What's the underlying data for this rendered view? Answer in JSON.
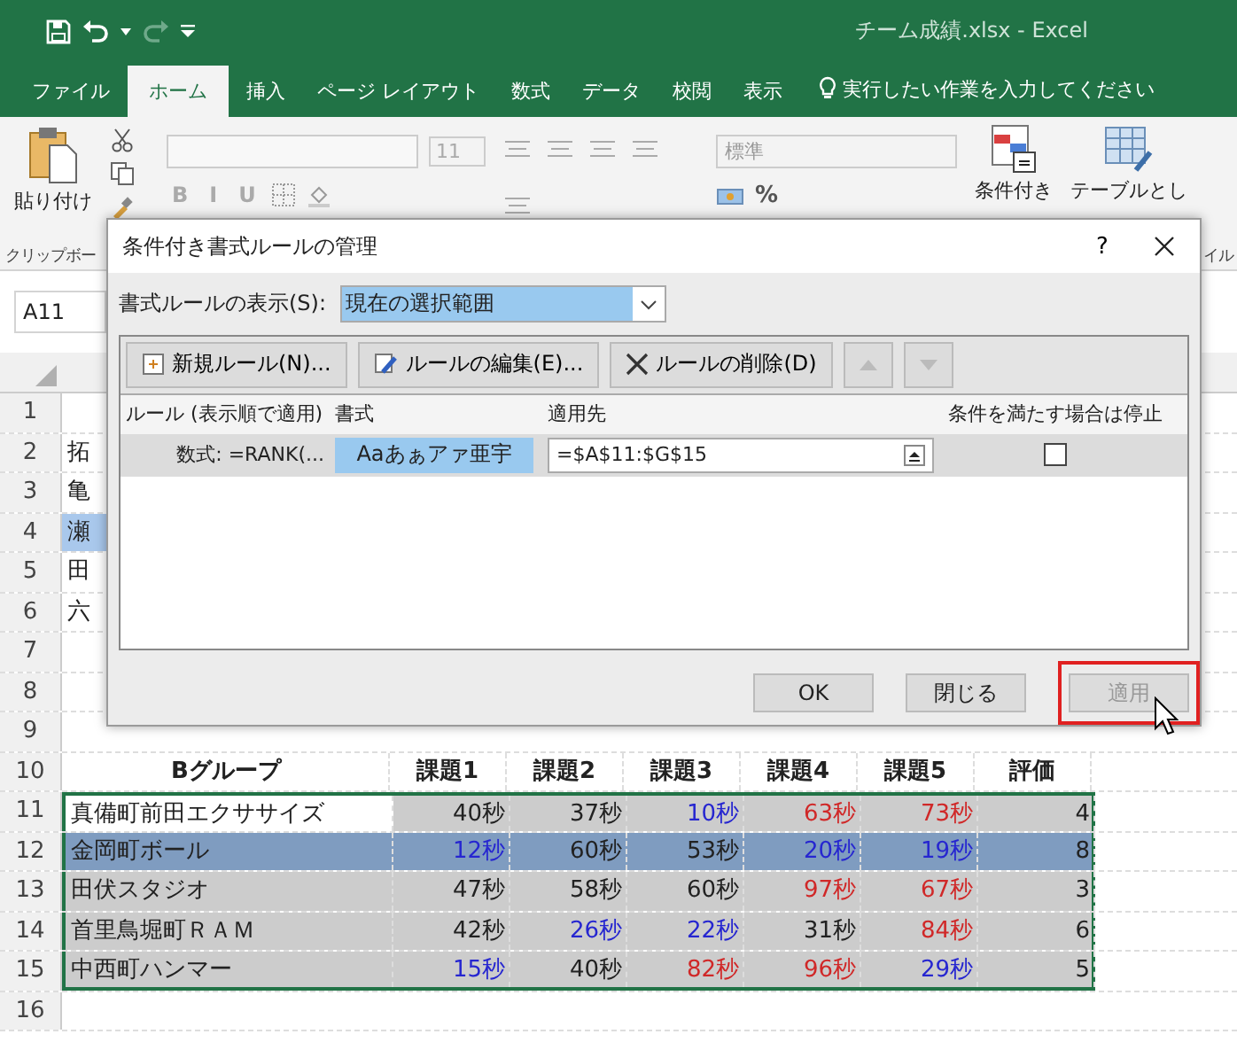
{
  "window": {
    "title": "チーム成績.xlsx  -  Excel"
  },
  "tabs": [
    {
      "label": "ファイル",
      "selected": false
    },
    {
      "label": "ホーム",
      "selected": true
    },
    {
      "label": "挿入",
      "selected": false
    },
    {
      "label": "ページ レイアウト",
      "selected": false
    },
    {
      "label": "数式",
      "selected": false
    },
    {
      "label": "データ",
      "selected": false
    },
    {
      "label": "校閲",
      "selected": false
    },
    {
      "label": "表示",
      "selected": false
    }
  ],
  "tell_me": "実行したい作業を入力してください",
  "ribbon": {
    "paste": "貼り付け",
    "font_size": "11",
    "font_styles": [
      "B",
      "I",
      "U"
    ],
    "number_format": "標準",
    "percent": "%",
    "conditional": "条件付き",
    "table": "テーブルとし",
    "group_left": "クリップボー",
    "group_right": "イル"
  },
  "name_box": "A11",
  "rows": [
    {
      "number": "1",
      "kind": "empty"
    },
    {
      "number": "2",
      "kind": "stub",
      "name": "拓",
      "highlighted": false
    },
    {
      "number": "3",
      "kind": "stub",
      "name": "亀",
      "highlighted": false
    },
    {
      "number": "4",
      "kind": "stub",
      "name": "瀬",
      "highlighted": true
    },
    {
      "number": "5",
      "kind": "stub",
      "name": "田",
      "highlighted": false
    },
    {
      "number": "6",
      "kind": "stub",
      "name": "六",
      "highlighted": false
    },
    {
      "number": "7",
      "kind": "empty"
    },
    {
      "number": "8",
      "kind": "empty"
    },
    {
      "number": "9",
      "kind": "empty"
    },
    {
      "number": "10",
      "kind": "header",
      "cells": [
        "Bグループ",
        "課題1",
        "課題2",
        "課題3",
        "課題4",
        "課題5",
        "評価"
      ]
    },
    {
      "number": "11",
      "kind": "data",
      "name": "真備町前田エクササイズ",
      "active": true,
      "highlighted": false,
      "scores": [
        {
          "text": "40秒",
          "color": "#222222"
        },
        {
          "text": "37秒",
          "color": "#222222"
        },
        {
          "text": "10秒",
          "color": "#2626d0"
        },
        {
          "text": "63秒",
          "color": "#d02828"
        },
        {
          "text": "73秒",
          "color": "#d02828"
        }
      ],
      "rating": "4"
    },
    {
      "number": "12",
      "kind": "data",
      "name": "金岡町ボール",
      "active": false,
      "highlighted": true,
      "scores": [
        {
          "text": "12秒",
          "color": "#2626d0"
        },
        {
          "text": "60秒",
          "color": "#222222"
        },
        {
          "text": "53秒",
          "color": "#222222"
        },
        {
          "text": "20秒",
          "color": "#2626d0"
        },
        {
          "text": "19秒",
          "color": "#2626d0"
        }
      ],
      "rating": "8"
    },
    {
      "number": "13",
      "kind": "data",
      "name": "田伏スタジオ",
      "active": false,
      "highlighted": false,
      "scores": [
        {
          "text": "47秒",
          "color": "#222222"
        },
        {
          "text": "58秒",
          "color": "#222222"
        },
        {
          "text": "60秒",
          "color": "#222222"
        },
        {
          "text": "97秒",
          "color": "#d02828"
        },
        {
          "text": "67秒",
          "color": "#d02828"
        }
      ],
      "rating": "3"
    },
    {
      "number": "14",
      "kind": "data",
      "name": "首里鳥堀町ＲＡＭ",
      "active": false,
      "highlighted": false,
      "scores": [
        {
          "text": "42秒",
          "color": "#222222"
        },
        {
          "text": "26秒",
          "color": "#2626d0"
        },
        {
          "text": "22秒",
          "color": "#2626d0"
        },
        {
          "text": "31秒",
          "color": "#222222"
        },
        {
          "text": "84秒",
          "color": "#d02828"
        }
      ],
      "rating": "6"
    },
    {
      "number": "15",
      "kind": "data",
      "name": "中西町ハンマー",
      "active": false,
      "highlighted": false,
      "scores": [
        {
          "text": "15秒",
          "color": "#2626d0"
        },
        {
          "text": "40秒",
          "color": "#222222"
        },
        {
          "text": "82秒",
          "color": "#d02828"
        },
        {
          "text": "96秒",
          "color": "#d02828"
        },
        {
          "text": "29秒",
          "color": "#2626d0"
        }
      ],
      "rating": "5"
    },
    {
      "number": "16",
      "kind": "empty"
    }
  ],
  "dialog": {
    "title": "条件付き書式ルールの管理",
    "help": "?",
    "show_label": "書式ルールの表示(S):",
    "show_value": "現在の選択範囲",
    "toolbar": [
      {
        "kind": "new",
        "label": "新規ルール(N)...",
        "disabled": false
      },
      {
        "kind": "edit",
        "label": "ルールの編集(E)...",
        "disabled": false
      },
      {
        "kind": "delete",
        "label": "ルールの削除(D)",
        "disabled": false
      },
      {
        "kind": "up",
        "disabled": true
      },
      {
        "kind": "down",
        "disabled": true
      }
    ],
    "columns": [
      "ルール (表示順で適用)",
      "書式",
      "適用先",
      "条件を満たす場合は停止"
    ],
    "rules": [
      {
        "rule": "数式: =RANK(...",
        "preview": "Aaあぁアァ亜宇",
        "applies_to": "=$A$11:$G$15",
        "stop_if_true": false,
        "selected": true
      }
    ],
    "buttons": [
      {
        "label": "OK",
        "disabled": false,
        "highlighted": false
      },
      {
        "label": "閉じる",
        "disabled": false,
        "highlighted": false
      },
      {
        "label": "適用",
        "disabled": true,
        "highlighted": true
      }
    ]
  }
}
